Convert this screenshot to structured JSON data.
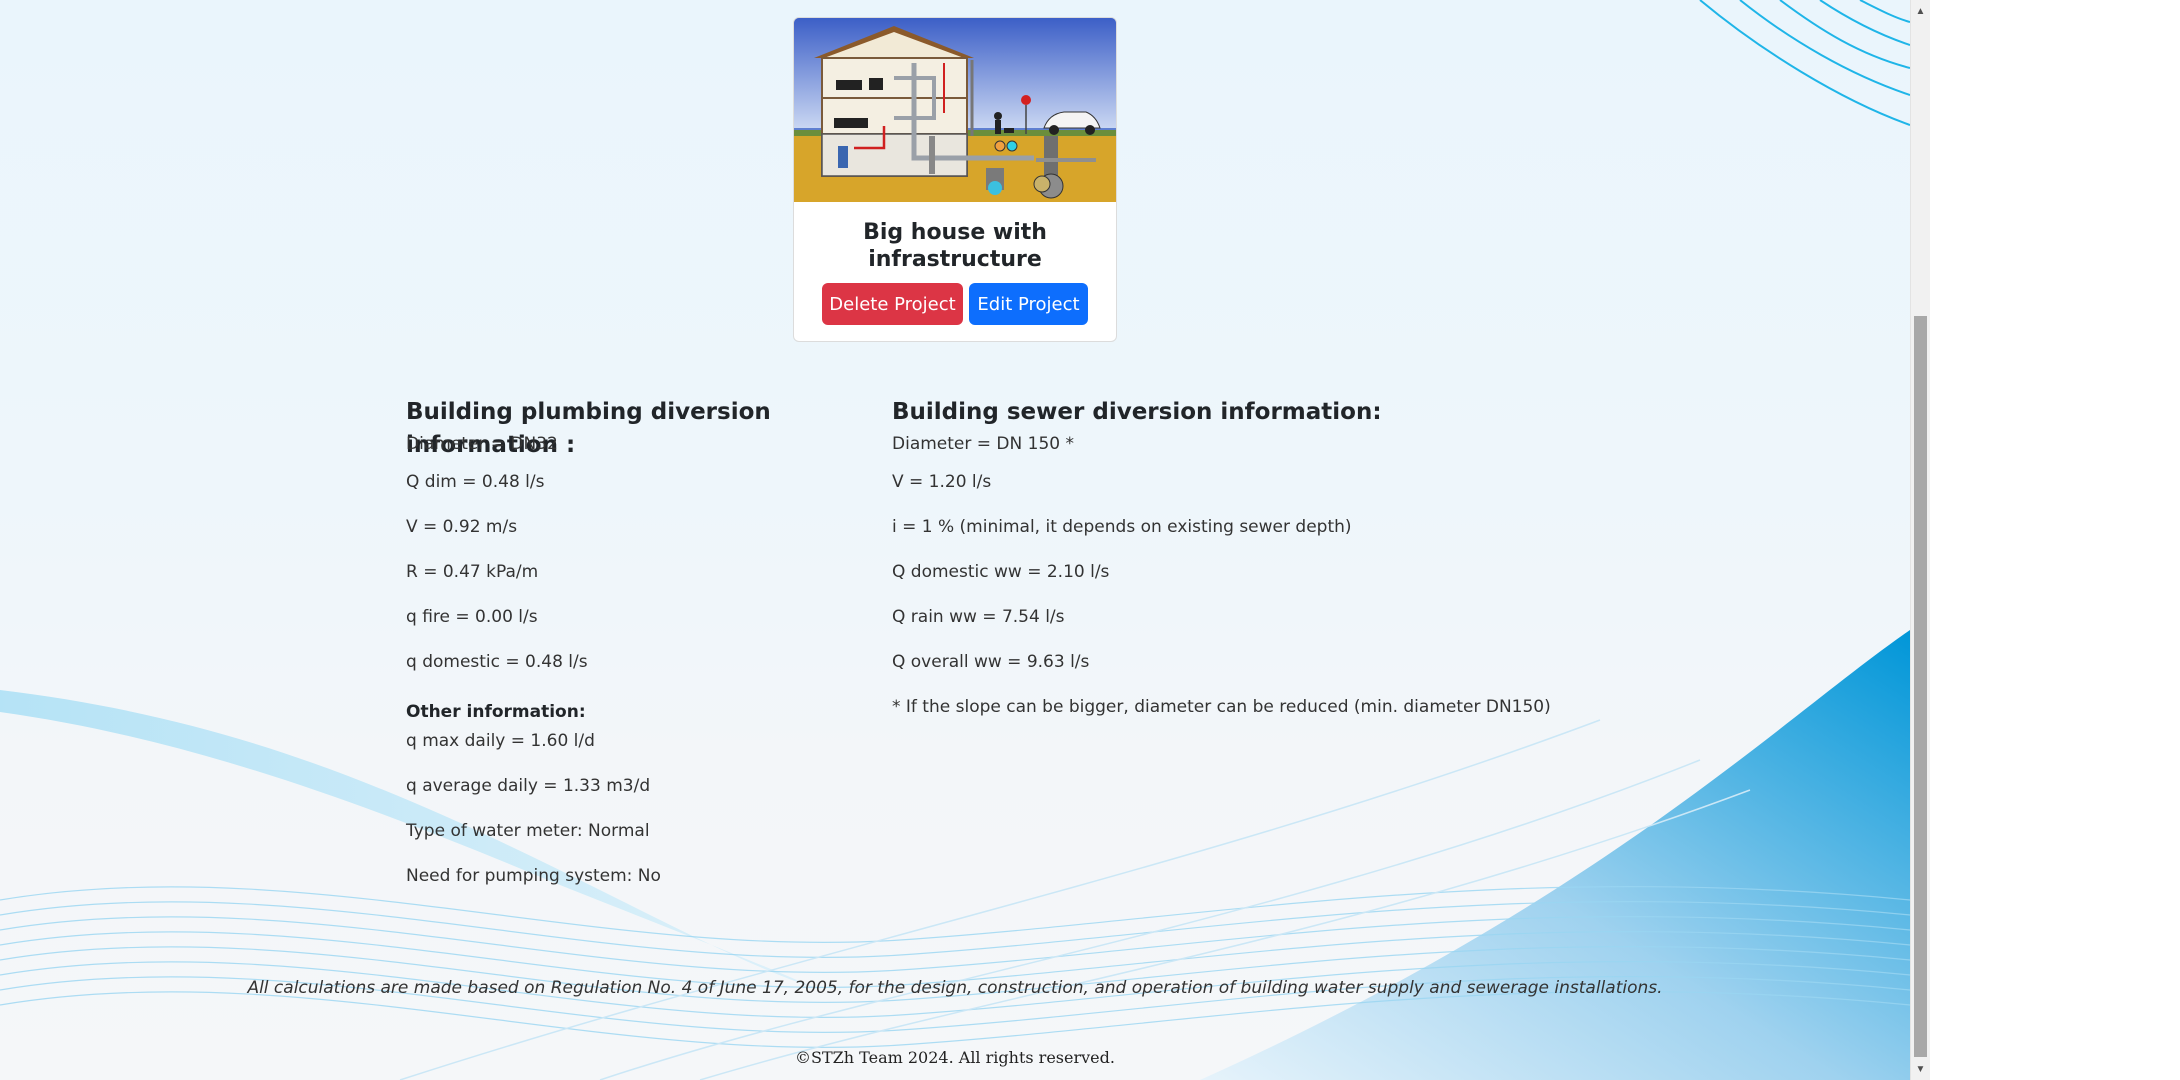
{
  "project": {
    "title": "Big house with infrastructure",
    "delete_label": "Delete Project",
    "edit_label": "Edit Project"
  },
  "plumbing": {
    "heading": "Building plumbing diversion information :",
    "lines": [
      "Diameter = DN32",
      "Q dim = 0.48 l/s",
      "V = 0.92 m/s",
      "R = 0.47 kPa/m",
      "q fire = 0.00 l/s",
      "q domestic = 0.48 l/s"
    ],
    "other_heading": "Other information:",
    "other_lines": [
      "q max daily = 1.60 l/d",
      "q average daily = 1.33 m3/d",
      "Type of water meter: Normal",
      "Need for pumping system: No"
    ]
  },
  "sewer": {
    "heading": "Building sewer diversion information:",
    "lines": [
      "Diameter = DN 150 *",
      "V = 1.20 l/s",
      "i = 1 % (minimal, it depends on existing sewer depth)",
      "Q domestic ww = 2.10 l/s",
      "Q rain ww = 7.54 l/s",
      "Q overall ww = 9.63 l/s",
      "* If the slope can be bigger, diameter can be reduced (min. diameter DN150)"
    ]
  },
  "footer": {
    "note": "All calculations are made based on Regulation No. 4 of June 17, 2005, for the design, construction, and operation of building water supply and sewerage installations.",
    "copyright": "©STZh Team 2024. All rights reserved."
  },
  "scrollbar": {
    "up_icon": "▲",
    "down_icon": "▼"
  }
}
